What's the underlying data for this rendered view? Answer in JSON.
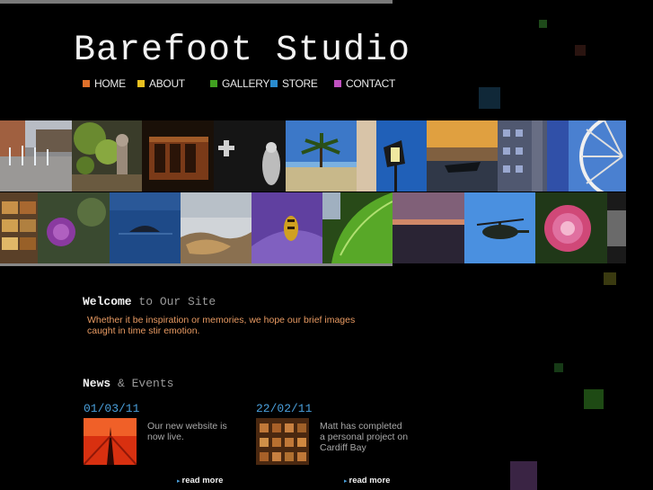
{
  "site": {
    "title": "Barefoot Studio"
  },
  "nav": {
    "items": [
      {
        "label": "HOME",
        "color": "#e0702a"
      },
      {
        "label": "ABOUT",
        "color": "#e8c020"
      },
      {
        "label": "GALLERY",
        "color": "#40a020"
      },
      {
        "label": "STORE",
        "color": "#2a8cd0"
      },
      {
        "label": "CONTACT",
        "color": "#c050c0"
      }
    ]
  },
  "welcome": {
    "title_bold": "Welcome",
    "title_rest": " to Our Site",
    "text": "Whether it be inspiration or memories, we hope our brief images caught in time stir emotion."
  },
  "news": {
    "title_bold": "News",
    "title_rest": " & Events",
    "items": [
      {
        "date": "01/03/11",
        "text": "Our new website is now live.",
        "read_more": "read more"
      },
      {
        "date": "22/02/11",
        "text": "Matt has completed a personal project on Cardiff Bay",
        "read_more": "read more"
      }
    ]
  },
  "gallery": {
    "images": [
      "fountain-plaza",
      "leaves-statue",
      "rusty-machine",
      "stone-cross-bw",
      "palm-tree-beach",
      "street-lamp",
      "boat-sunset",
      "building-facade",
      "ferris-wheel",
      "market-stall",
      "purple-thistle",
      "whale-sea",
      "shore-rocks",
      "wasp-on-flower",
      "green-leaf",
      "sunset-sea",
      "helicopter-sky",
      "pink-dahlia",
      "rock-edge"
    ]
  }
}
